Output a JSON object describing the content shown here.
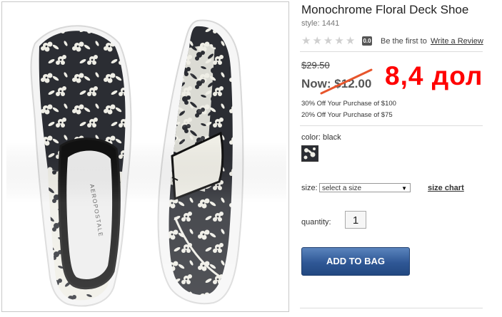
{
  "product": {
    "title": "Monochrome Floral Deck Shoe",
    "style_label": "style: 1441"
  },
  "reviews": {
    "score": "0.0",
    "prompt": "Be the first to",
    "link": "Write a Review"
  },
  "price": {
    "was": "$29.50",
    "now_prefix": "Now:",
    "now_value": "$12.00",
    "annotation": "8,4 дол"
  },
  "promos": [
    "30% Off Your Purchase of $100",
    "20% Off Your Purchase of $75"
  ],
  "color": {
    "label": "color:",
    "value": "black"
  },
  "size": {
    "label": "size:",
    "selected": "select a size",
    "chart_link": "size chart"
  },
  "quantity": {
    "label": "quantity:",
    "value": "1"
  },
  "cart": {
    "button": "ADD TO BAG"
  },
  "shoe_logo": "AEROPOSTALE",
  "colors": {
    "annotation": "#ff0000",
    "button": "#2f5795",
    "pattern_dark": "#2b2d33",
    "pattern_light": "#efeee6"
  }
}
